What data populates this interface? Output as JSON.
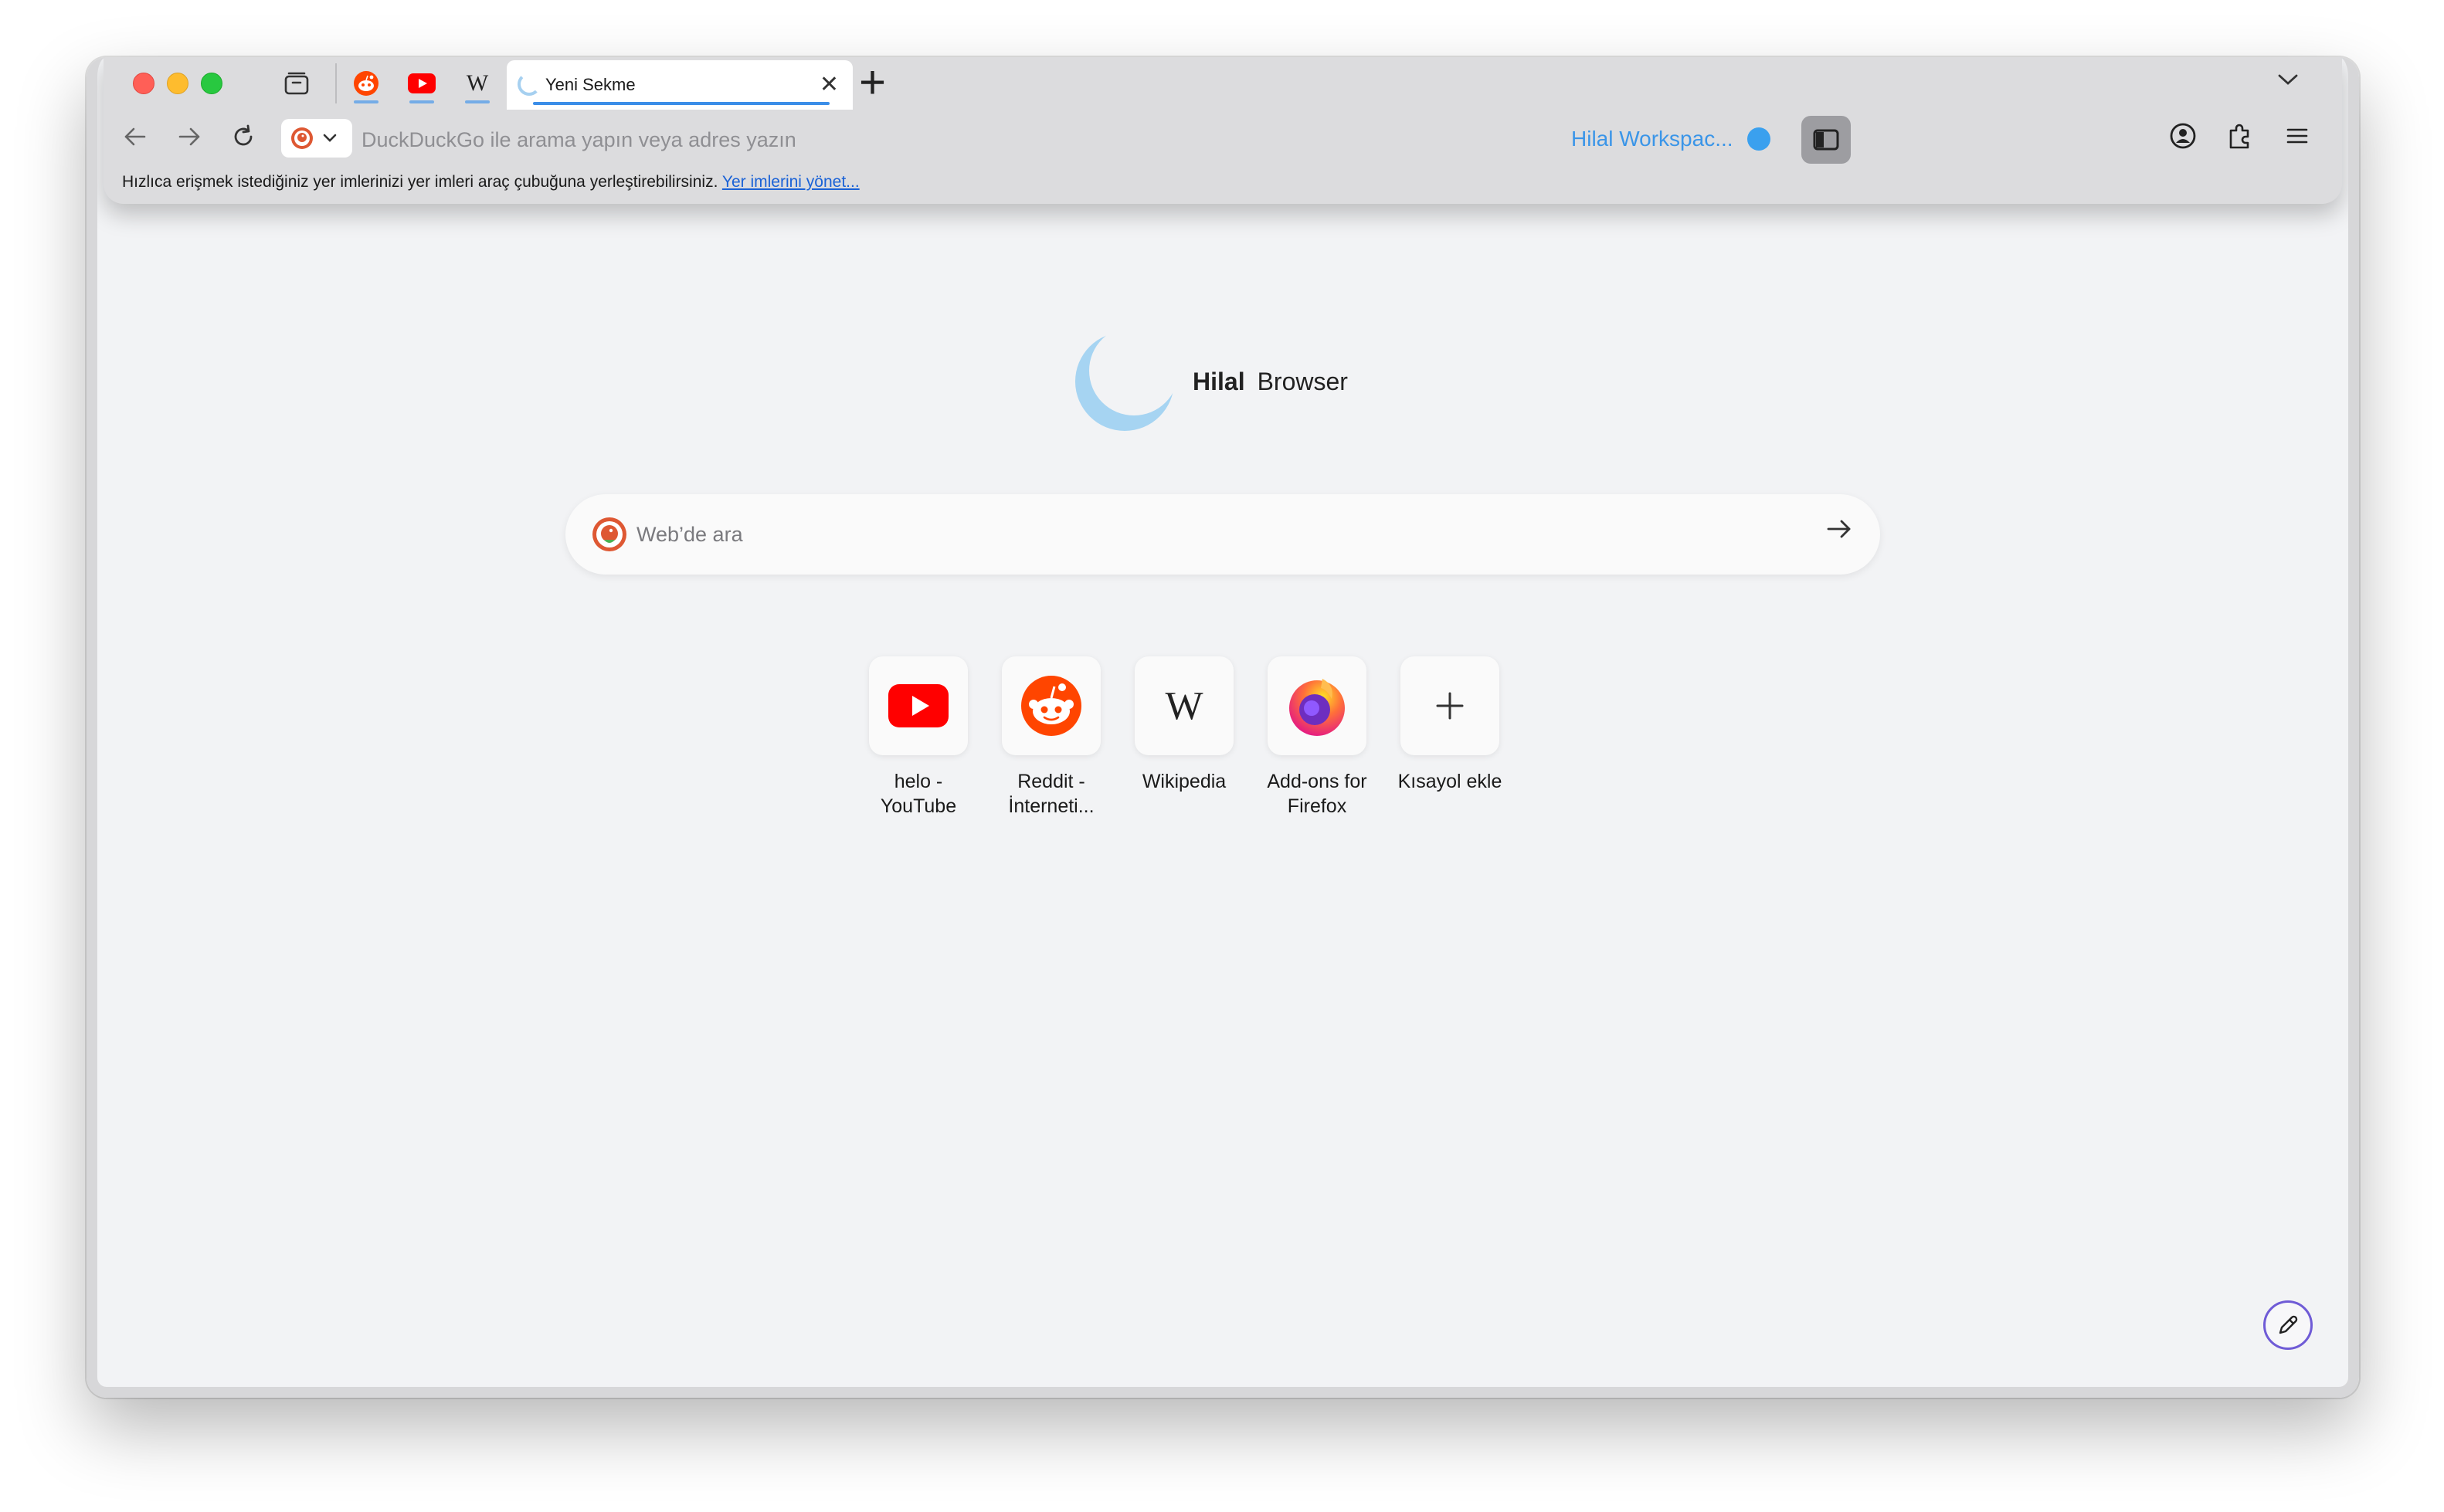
{
  "tabs": {
    "active_title": "Yeni Sekme",
    "pinned": [
      "reddit-icon",
      "youtube-icon",
      "wikipedia-icon"
    ]
  },
  "toolbar": {
    "url_placeholder": "DuckDuckGo ile arama yapın veya adres yazın",
    "workspace_label": "Hilal Workspac..."
  },
  "bookmarks_bar": {
    "message": "Hızlıca erişmek istediğiniz yer imlerinizi yer imleri araç çubuğuna yerleştirebilirsiniz.",
    "manage_link": "Yer imlerini yönet..."
  },
  "brand": {
    "name_bold": "Hilal",
    "name_rest": "Browser"
  },
  "search": {
    "placeholder": "Web’de ara"
  },
  "shortcuts": [
    {
      "label": "helo -\nYouTube",
      "icon": "youtube-icon"
    },
    {
      "label": "Reddit -\nİnterneti...",
      "icon": "reddit-icon"
    },
    {
      "label": "Wikipedia",
      "icon": "wikipedia-icon"
    },
    {
      "label": "Add-ons for\nFirefox",
      "icon": "firefox-icon"
    },
    {
      "label": "Kısayol ekle",
      "icon": "plus-icon"
    }
  ],
  "colors": {
    "accent": "#3a95e8",
    "youtube_red": "#ff0000",
    "reddit_orange": "#ff4500"
  }
}
